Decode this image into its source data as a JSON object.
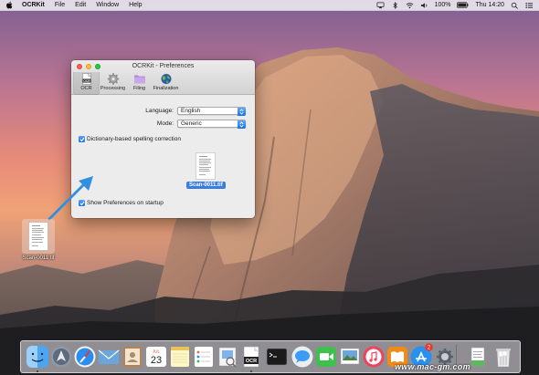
{
  "menubar": {
    "app_name": "OCRKit",
    "items": [
      "File",
      "Edit",
      "Window",
      "Help"
    ],
    "battery": "100%",
    "time": "Thu 14:20"
  },
  "window": {
    "title": "OCRKit - Preferences",
    "toolbar": [
      {
        "label": "OCR",
        "icon": "ocr-icon",
        "selected": true
      },
      {
        "label": "Processing",
        "icon": "gear-icon",
        "selected": false
      },
      {
        "label": "Filing",
        "icon": "folder-icon",
        "selected": false
      },
      {
        "label": "Finalization",
        "icon": "globe-icon",
        "selected": false
      }
    ],
    "language": {
      "label": "Language:",
      "value": "English"
    },
    "mode": {
      "label": "Mode:",
      "value": "Generic"
    },
    "spelling_checkbox": {
      "label": "Dictionary-based spelling correction",
      "checked": true
    },
    "startup_checkbox": {
      "label": "Show Preferences on startup",
      "checked": true
    },
    "dropped_file": "Scan-0011.tif"
  },
  "desktop": {
    "file_label": "Scan-0011.tif"
  },
  "dock": {
    "apps": [
      "finder-icon",
      "launchpad-icon",
      "safari-icon",
      "mail-icon",
      "contacts-icon",
      "calendar-icon",
      "notes-icon",
      "reminders-icon",
      "preview-icon",
      "ocrkit-icon",
      "terminal-icon",
      "messages-icon",
      "facetime-icon",
      "photos-icon",
      "itunes-icon",
      "ibooks-icon",
      "app-store-icon",
      "system-preferences-icon",
      "document-icon",
      "trash-icon"
    ],
    "calendar_date": "23",
    "calendar_month": "JUL",
    "ocrkit_label": "OCR",
    "app_store_badge": "2"
  },
  "watermark": "www.mac-gm.com",
  "colors": {
    "accent": "#3b7ce3",
    "arrow": "#2f8fe0"
  }
}
